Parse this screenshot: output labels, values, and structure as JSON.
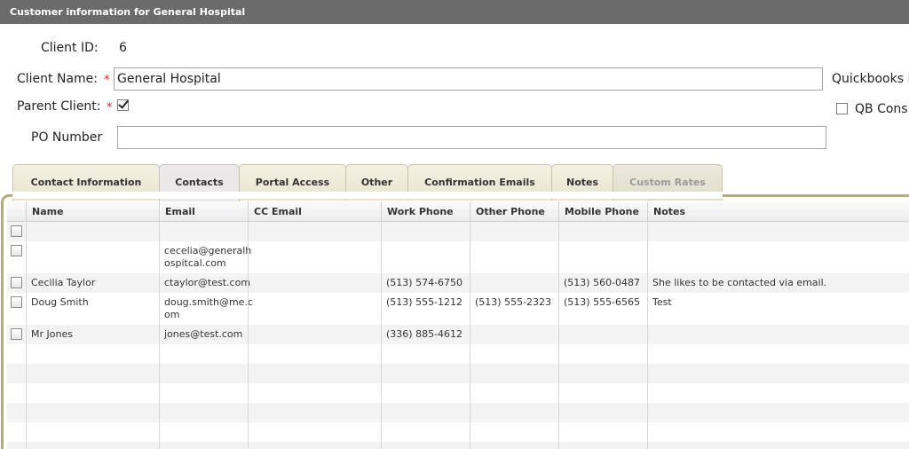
{
  "window": {
    "title": "Customer information for General Hospital"
  },
  "form": {
    "client_id_label": "Client ID:",
    "client_id_value": "6",
    "client_name_label": "Client Name:",
    "client_name_value": "General Hospital",
    "parent_client_label": "Parent Client:",
    "parent_client_checked": true,
    "po_number_label": "PO Number",
    "po_number_value": "",
    "quickbooks_label": "Quickbooks N",
    "qb_cons_label": "QB Cons",
    "required_marker": "*"
  },
  "tabs": [
    {
      "label": "Contact Information",
      "state": "normal"
    },
    {
      "label": "Contacts",
      "state": "active"
    },
    {
      "label": "Portal Access",
      "state": "normal"
    },
    {
      "label": "Other",
      "state": "normal"
    },
    {
      "label": "Confirmation Emails",
      "state": "normal"
    },
    {
      "label": "Notes",
      "state": "normal"
    },
    {
      "label": "Custom Rates",
      "state": "disabled"
    }
  ],
  "table": {
    "columns": [
      "Name",
      "Email",
      "CC Email",
      "Work Phone",
      "Other Phone",
      "Mobile Phone",
      "Notes"
    ],
    "rows": [
      {
        "name": "",
        "email": "",
        "cc_email": "",
        "work_phone": "",
        "other_phone": "",
        "mobile_phone": "",
        "notes": ""
      },
      {
        "name": "",
        "email": "cecelia@generalh ospitcal.com",
        "cc_email": "",
        "work_phone": "",
        "other_phone": "",
        "mobile_phone": "",
        "notes": ""
      },
      {
        "name": "Cecilia Taylor",
        "email": "ctaylor@test.com",
        "cc_email": "",
        "work_phone": "(513) 574-6750",
        "other_phone": "",
        "mobile_phone": "(513) 560-0487",
        "notes": "She likes to be contacted via email."
      },
      {
        "name": "Doug Smith",
        "email": "doug.smith@me.c om",
        "cc_email": "",
        "work_phone": "(513) 555-1212",
        "other_phone": "(513) 555-2323",
        "mobile_phone": "(513) 555-6565",
        "notes": "Test"
      },
      {
        "name": "Mr Jones",
        "email": "jones@test.com",
        "cc_email": "",
        "work_phone": "(336) 885-4612",
        "other_phone": "",
        "mobile_phone": "",
        "notes": ""
      }
    ]
  },
  "colors": {
    "titlebar": "#6b6b6b",
    "panel_border": "#b3ad7d",
    "required": "#dd2222"
  }
}
